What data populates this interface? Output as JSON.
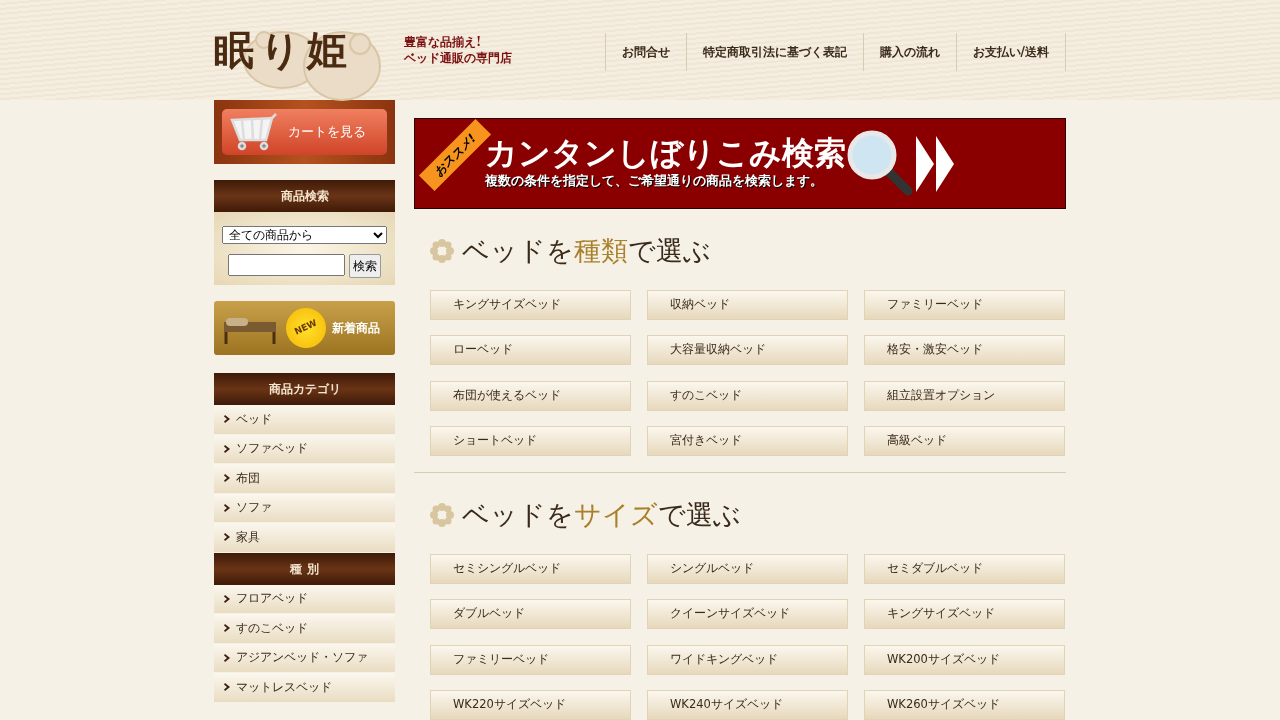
{
  "header": {
    "logo": "眠り姫",
    "tagline": [
      "豊富な品揃え!",
      "ベッド通販の専門店"
    ],
    "nav": [
      "お問合せ",
      "特定商取引法に基づく表記",
      "購入の流れ",
      "お支払い/送料"
    ]
  },
  "sidebar": {
    "cart_button": "カートを見る",
    "search": {
      "title": "商品検索",
      "select_value": "全ての商品から",
      "button": "検索"
    },
    "new_button": {
      "badge": "NEW",
      "label": "新着商品"
    },
    "menus": [
      {
        "title": "商品カテゴリ",
        "items": [
          "ベッド",
          "ソファベッド",
          "布団",
          "ソファ",
          "家具"
        ]
      },
      {
        "title": "種 別",
        "items": [
          "フロアベッド",
          "すのこベッド",
          "アジアンベッド・ソファ",
          "マットレスベッド"
        ]
      }
    ]
  },
  "banner": {
    "badge": "おススメ!",
    "title": "カンタンしぼりこみ検索",
    "subtitle": "複数の条件を指定して、ご希望通りの商品を検索します。"
  },
  "sections": [
    {
      "heading": {
        "before": "ベッドを",
        "highlight": "種類",
        "after": "で選ぶ"
      },
      "items": [
        "キングサイズベッド",
        "収納ベッド",
        "ファミリーベッド",
        "ローベッド",
        "大容量収納ベッド",
        "格安・激安ベッド",
        "布団が使えるベッド",
        "すのこベッド",
        "組立設置オプション",
        "ショートベッド",
        "宮付きベッド",
        "高級ベッド"
      ]
    },
    {
      "heading": {
        "before": "ベッドを",
        "highlight": "サイズ",
        "after": "で選ぶ"
      },
      "items": [
        "セミシングルベッド",
        "シングルベッド",
        "セミダブルベッド",
        "ダブルベッド",
        "クイーンサイズベッド",
        "キングサイズベッド",
        "ファミリーベッド",
        "ワイドキングベッド",
        "WK200サイズベッド",
        "WK220サイズベッド",
        "WK240サイズベッド",
        "WK260サイズベッド"
      ]
    }
  ]
}
